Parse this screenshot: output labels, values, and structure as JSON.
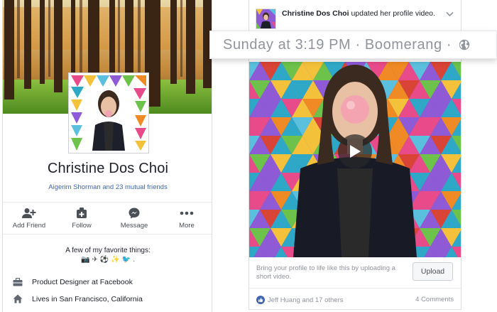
{
  "profile": {
    "name": "Christine Dos Choi",
    "mutual_friends": "Aigerim Shorman and 23 mutual friends",
    "actions": [
      {
        "label": "Add Friend",
        "icon": "add-friend-icon"
      },
      {
        "label": "Follow",
        "icon": "follow-icon"
      },
      {
        "label": "Message",
        "icon": "messenger-icon"
      },
      {
        "label": "More",
        "icon": "more-icon"
      }
    ],
    "favorites_title": "A few of my favorite things:",
    "favorites_emoji": [
      "📷",
      "✈",
      "⚽",
      "✨",
      "🐦",
      "."
    ],
    "work": "Product Designer at Facebook",
    "city": "Lives in San Francisco, California"
  },
  "post": {
    "author": "Christine Dos Choi",
    "action_text": "updated her profile video.",
    "timestamp": "Sunday at 3:19 PM",
    "app": "Boomerang",
    "separator": "·",
    "cta_text": "Bring your profile to life like this by uploading a short video.",
    "upload_label": "Upload",
    "likes_text": "Jeff Huang and 17 others",
    "comments_text": "4 Comments"
  },
  "colors": {
    "link": "#4267b2",
    "muted": "#90949c",
    "border": "#dddfe2"
  }
}
